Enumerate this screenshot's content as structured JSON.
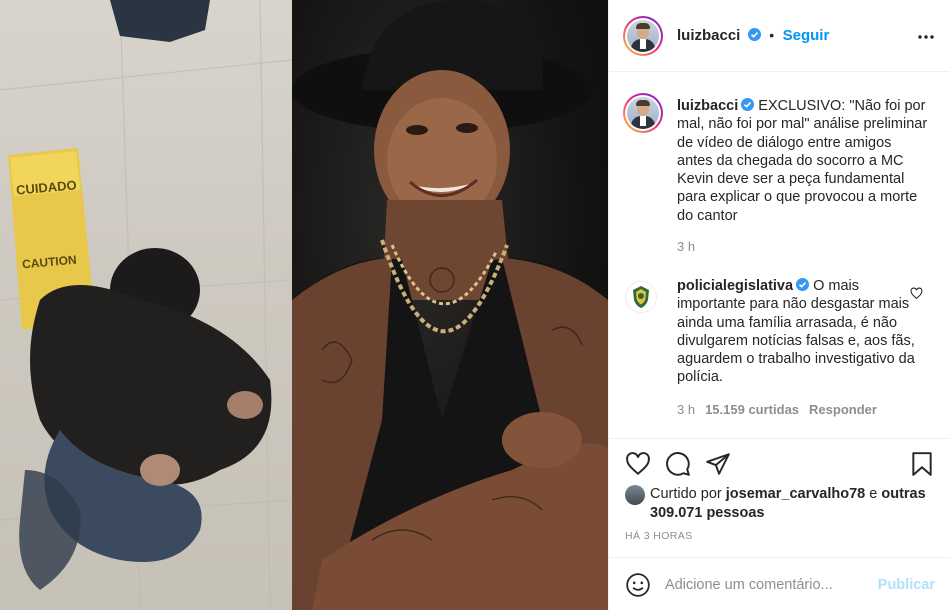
{
  "post": {
    "author": "luizbacci",
    "follow_label": "Seguir",
    "dot": "•",
    "caption": {
      "author": "luizbacci",
      "text": "EXCLUSIVO: \"Não foi por mal, não foi por mal\" análise preliminar de vídeo de diálogo entre amigos antes da chegada do socorro a MC Kevin deve ser a peça fundamental para explicar o que provocou a morte do cantor",
      "time": "3 h"
    },
    "comments": [
      {
        "author": "policialegislativa",
        "text": "O mais importante para não desgastar mais ainda uma família arrasada, é não divulgarem notícias falsas e, aos fãs, aguardem o trabalho investigativo da polícia.",
        "time": "3 h",
        "likes": "15.159 curtidas",
        "reply_label": "Responder"
      }
    ],
    "liked_by_prefix": "Curtido por",
    "liked_by_user": "josemar_carvalho78",
    "liked_by_and": "e",
    "liked_by_others": "outras 309.071 pessoas",
    "posted_ago": "HÁ 3 HORAS",
    "comment_placeholder": "Adicione um comentário...",
    "publish_label": "Publicar"
  },
  "media": {
    "left_sign_top": "CUIDADO",
    "left_sign_bottom": "CAUTION"
  },
  "icons": {
    "verified": "verified-badge-icon",
    "more": "more-options-icon",
    "like": "heart-icon",
    "comment": "comment-bubble-icon",
    "share": "paper-plane-icon",
    "save": "bookmark-icon",
    "emoji": "emoji-icon"
  },
  "colors": {
    "accent": "#0095f6",
    "verified": "#3897f0",
    "muted": "#8e8e8e",
    "publish_disabled": "#b2dffc"
  }
}
